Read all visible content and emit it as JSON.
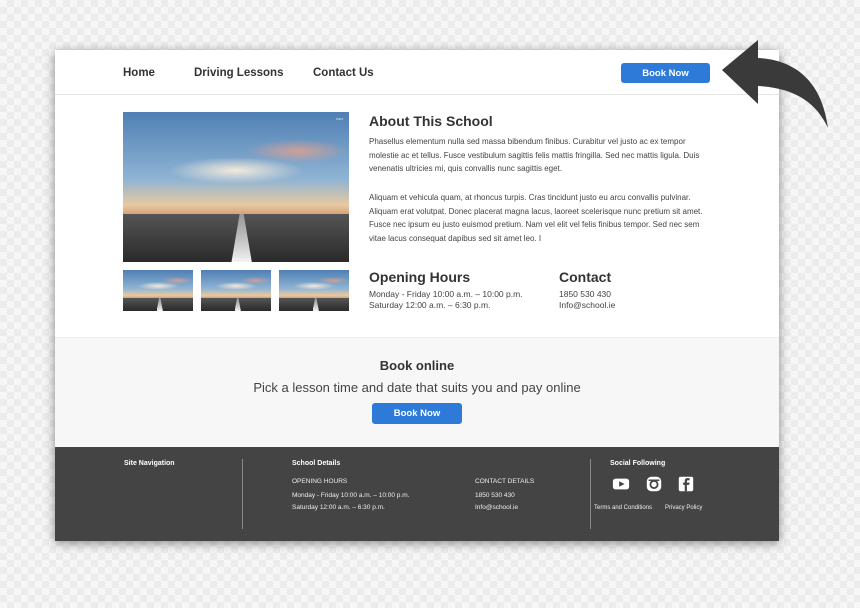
{
  "nav": {
    "links": [
      "Home",
      "Driving Lessons",
      "Contact Us"
    ],
    "book_now": "Book Now"
  },
  "hero": {
    "image_label": "•••••"
  },
  "about": {
    "title": "About This School",
    "para1": "Phasellus elementum nulla sed massa bibendum finibus. Curabitur vel justo ac ex tempor molestie ac et tellus. Fusce vestibulum sagittis felis mattis fringilla. Sed nec mattis ligula. Duis venenatis ultricies mi, quis convallis nunc sagittis eget.",
    "para2": "Aliquam et vehicula quam, at rhoncus turpis. Cras tincidunt justo eu arcu convallis pulvinar. Aliquam erat volutpat. Donec placerat magna lacus, laoreet scelerisque nunc pretium sit amet. Fusce nec ipsum eu justo euismod pretium. Nam vel elit vel felis finibus tempor. Sed nec sem vitae lacus consequat dapibus sed sit amet leo. I"
  },
  "hours": {
    "title": "Opening Hours",
    "line1": "Monday - Friday 10:00 a.m. – 10:00 p.m.",
    "line2": "Saturday 12:00 a.m. – 6:30 p.m."
  },
  "contact": {
    "title": "Contact",
    "phone": "1850 530 430",
    "email": "Info@school.ie"
  },
  "book_online": {
    "title": "Book online",
    "subtitle": "Pick a lesson time and date that suits you and pay online",
    "button": "Book Now"
  },
  "footer": {
    "site_nav": "Site Navigation",
    "school_details": "School Details",
    "opening_hours_label": "OPENING HOURS",
    "hours1": "Monday - Friday 10:00 a.m. – 10:00 p.m.",
    "hours2": "Saturday 12:00 a.m. – 6:30 p.m.",
    "contact_label": "CONTACT DETAILS",
    "phone": "1850 530 430",
    "email": "Info@school.ie",
    "social": "Social Following",
    "social_icons": [
      "youtube-icon",
      "instagram-icon",
      "facebook-icon"
    ],
    "terms": "Terms and Conditions",
    "privacy": "Privacy Policy"
  },
  "colors": {
    "accent": "#2e7ad8",
    "footer_bg": "#444444",
    "band_bg": "#f7f7f7",
    "arrow": "#3a3a3a"
  }
}
